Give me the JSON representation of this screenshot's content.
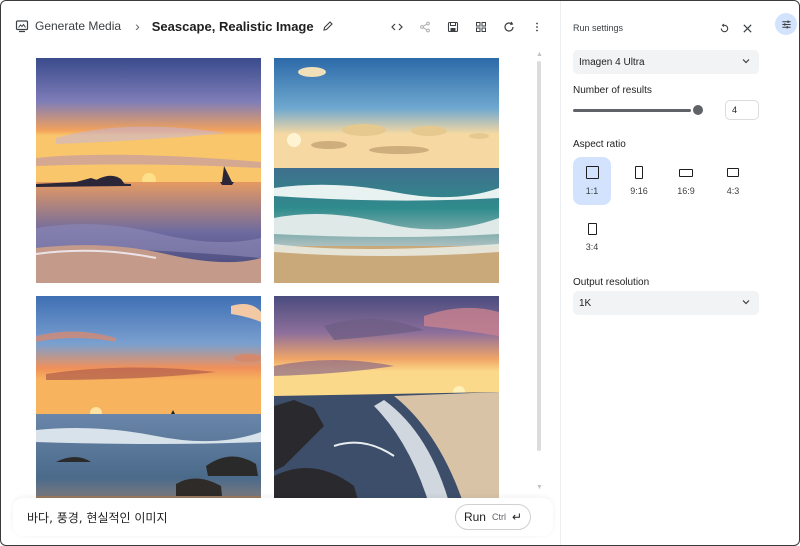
{
  "header": {
    "breadcrumb_label": "Generate Media",
    "title": "Seascape, Realistic Image",
    "toolbar_icons": [
      "code-icon",
      "share-icon",
      "save-icon",
      "grid-icon",
      "refresh-icon",
      "more-vertical-icon"
    ]
  },
  "gallery": {
    "images": [
      {
        "description_icon": "sunset-sailboat-image"
      },
      {
        "description_icon": "waves-clouds-image"
      },
      {
        "description_icon": "sunset-rocks-image"
      },
      {
        "description_icon": "rocky-shore-image"
      }
    ]
  },
  "prompt": {
    "text": "바다, 풍경, 현실적인 이미지",
    "run_label": "Run",
    "shortcut": "Ctrl",
    "enter_glyph": "↵"
  },
  "settings": {
    "title": "Run settings",
    "model": "Imagen 4 Ultra",
    "results_label": "Number of results",
    "results_value": "4",
    "results_fraction": 1.0,
    "aspect_label": "Aspect ratio",
    "aspect_options": [
      "1:1",
      "9:16",
      "16:9",
      "4:3",
      "3:4"
    ],
    "aspect_selected": "1:1",
    "output_label": "Output resolution",
    "output_value": "1K"
  },
  "colors": {
    "accent": "#d3e3fd",
    "slider": "#5f6368"
  }
}
